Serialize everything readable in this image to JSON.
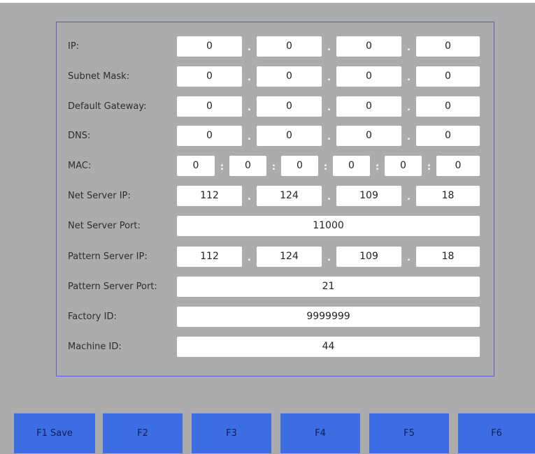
{
  "network_settings": {
    "ip": {
      "label": "IP:",
      "octets": [
        "0",
        "0",
        "0",
        "0"
      ]
    },
    "subnet_mask": {
      "label": "Subnet Mask:",
      "octets": [
        "0",
        "0",
        "0",
        "0"
      ]
    },
    "default_gateway": {
      "label": "Default Gateway:",
      "octets": [
        "0",
        "0",
        "0",
        "0"
      ]
    },
    "dns": {
      "label": "DNS:",
      "octets": [
        "0",
        "0",
        "0",
        "0"
      ]
    },
    "mac": {
      "label": "MAC:",
      "parts": [
        "0",
        "0",
        "0",
        "0",
        "0",
        "0"
      ]
    },
    "net_server_ip": {
      "label": "Net Server IP:",
      "octets": [
        "112",
        "124",
        "109",
        "18"
      ]
    },
    "net_server_port": {
      "label": "Net Server Port:",
      "value": "11000"
    },
    "pattern_server_ip": {
      "label": "Pattern Server IP:",
      "octets": [
        "112",
        "124",
        "109",
        "18"
      ]
    },
    "pattern_server_port": {
      "label": "Pattern Server Port:",
      "value": "21"
    },
    "factory_id": {
      "label": "Factory ID:",
      "value": "9999999"
    },
    "machine_id": {
      "label": "Machine ID:",
      "value": "44"
    },
    "ip_separator": ".",
    "mac_separator": ":"
  },
  "function_keys": [
    {
      "label": "F1 Save"
    },
    {
      "label": "F2"
    },
    {
      "label": "F3"
    },
    {
      "label": "F4"
    },
    {
      "label": "F5"
    },
    {
      "label": "F6"
    }
  ],
  "colors": {
    "background": "#acacac",
    "panel_border": "#5b5fc7",
    "button": "#3c6de2"
  }
}
